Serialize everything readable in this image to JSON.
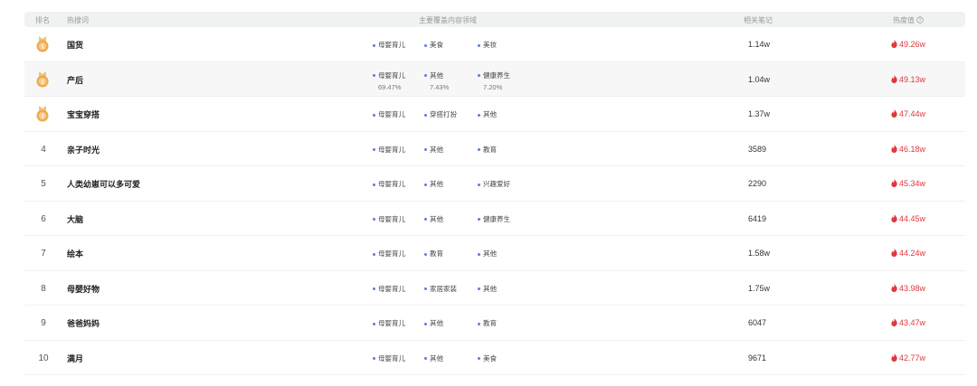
{
  "header": {
    "rank": "排名",
    "keyword": "热搜词",
    "domains": "主要覆盖内容领域",
    "notes": "相关笔记",
    "heat": "热度值"
  },
  "rows": [
    {
      "rank": "1",
      "medal": true,
      "keyword": "国货",
      "tags": [
        {
          "label": "母婴育儿"
        },
        {
          "label": "美食"
        },
        {
          "label": "美妆"
        }
      ],
      "notes": "1.14w",
      "heat": "49.26w"
    },
    {
      "rank": "2",
      "medal": true,
      "keyword": "产后",
      "tags": [
        {
          "label": "母婴育儿",
          "pct": "69.47%"
        },
        {
          "label": "其他",
          "pct": "7.43%"
        },
        {
          "label": "健康养生",
          "pct": "7.20%"
        }
      ],
      "notes": "1.04w",
      "heat": "49.13w"
    },
    {
      "rank": "3",
      "medal": true,
      "keyword": "宝宝穿搭",
      "tags": [
        {
          "label": "母婴育儿"
        },
        {
          "label": "穿搭打扮"
        },
        {
          "label": "其他"
        }
      ],
      "notes": "1.37w",
      "heat": "47.44w"
    },
    {
      "rank": "4",
      "keyword": "亲子时光",
      "tags": [
        {
          "label": "母婴育儿"
        },
        {
          "label": "其他"
        },
        {
          "label": "教育"
        }
      ],
      "notes": "3589",
      "heat": "46.18w"
    },
    {
      "rank": "5",
      "keyword": "人类幼崽可以多可爱",
      "tags": [
        {
          "label": "母婴育儿"
        },
        {
          "label": "其他"
        },
        {
          "label": "兴趣爱好"
        }
      ],
      "notes": "2290",
      "heat": "45.34w"
    },
    {
      "rank": "6",
      "keyword": "大脑",
      "tags": [
        {
          "label": "母婴育儿"
        },
        {
          "label": "其他"
        },
        {
          "label": "健康养生"
        }
      ],
      "notes": "6419",
      "heat": "44.45w"
    },
    {
      "rank": "7",
      "keyword": "绘本",
      "tags": [
        {
          "label": "母婴育儿"
        },
        {
          "label": "教育"
        },
        {
          "label": "其他"
        }
      ],
      "notes": "1.58w",
      "heat": "44.24w"
    },
    {
      "rank": "8",
      "keyword": "母婴好物",
      "tags": [
        {
          "label": "母婴育儿"
        },
        {
          "label": "家居家装"
        },
        {
          "label": "其他"
        }
      ],
      "notes": "1.75w",
      "heat": "43.98w"
    },
    {
      "rank": "9",
      "keyword": "爸爸妈妈",
      "tags": [
        {
          "label": "母婴育儿"
        },
        {
          "label": "其他"
        },
        {
          "label": "教育"
        }
      ],
      "notes": "6047",
      "heat": "43.47w"
    },
    {
      "rank": "10",
      "keyword": "满月",
      "tags": [
        {
          "label": "母婴育儿"
        },
        {
          "label": "其他"
        },
        {
          "label": "美食"
        }
      ],
      "notes": "9671",
      "heat": "42.77w"
    }
  ],
  "colors": {
    "accent": "#5b7be8",
    "heat": "#e0383e",
    "medal": "#f0a94a"
  },
  "icons": {
    "medal": "medal-icon",
    "heat": "flame-icon",
    "help": "question-circle-icon"
  }
}
